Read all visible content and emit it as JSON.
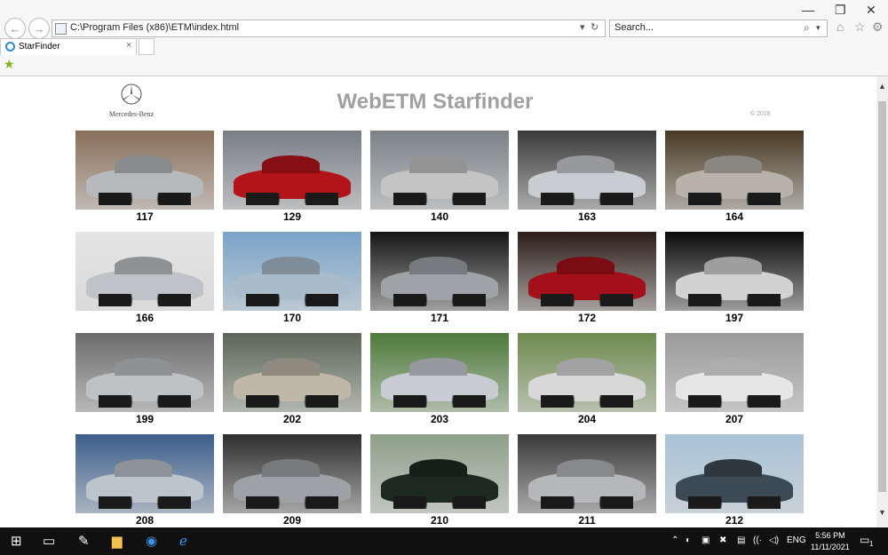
{
  "browser": {
    "address_url": "C:\\Program Files (x86)\\ETM\\index.html",
    "search_placeholder": "Search...",
    "tab_title": "StarFinder"
  },
  "page": {
    "logo_text": "Mercedes-Benz",
    "title": "WebETM Starfinder",
    "copyright": "© 2016"
  },
  "models": [
    {
      "code": "117",
      "color": "#b7b9bc",
      "bg": "#8a6f5a"
    },
    {
      "code": "129",
      "color": "#b3141a",
      "bg": "#7a7f86"
    },
    {
      "code": "140",
      "color": "#c4c4c4",
      "bg": "#7c8288"
    },
    {
      "code": "163",
      "color": "#c9ccd0",
      "bg": "#3b3b3b"
    },
    {
      "code": "164",
      "color": "#b8b3aa",
      "bg": "#4a3a24"
    },
    {
      "code": "166",
      "color": "#bfc2c6",
      "bg": "#e4e4e4"
    },
    {
      "code": "170",
      "color": "#a9bccb",
      "bg": "#7aa4c8"
    },
    {
      "code": "171",
      "color": "#9fa3a8",
      "bg": "#151515"
    },
    {
      "code": "172",
      "color": "#a4101a",
      "bg": "#2c1d18"
    },
    {
      "code": "197",
      "color": "#d2d2d2",
      "bg": "#0a0a0a"
    },
    {
      "code": "199",
      "color": "#bfc2c5",
      "bg": "#6c6c6c"
    },
    {
      "code": "202",
      "color": "#bfb8a8",
      "bg": "#5b6655"
    },
    {
      "code": "203",
      "color": "#c8ccd2",
      "bg": "#4e7a3a"
    },
    {
      "code": "204",
      "color": "#d8d8d8",
      "bg": "#6e8a4e"
    },
    {
      "code": "207",
      "color": "#e6e6e6",
      "bg": "#9a9a9a"
    },
    {
      "code": "208",
      "color": "#bcc4cc",
      "bg": "#3d5f8c"
    },
    {
      "code": "209",
      "color": "#9ea2a6",
      "bg": "#2e2e2e"
    },
    {
      "code": "210",
      "color": "#1d2a22",
      "bg": "#8ea08a"
    },
    {
      "code": "211",
      "color": "#b5b7ba",
      "bg": "#3a3a3a"
    },
    {
      "code": "212",
      "color": "#3c4a56",
      "bg": "#a9c3d8"
    }
  ],
  "taskbar": {
    "language": "ENG",
    "time": "5:56 PM",
    "date": "11/11/2021",
    "notifications": "1"
  }
}
